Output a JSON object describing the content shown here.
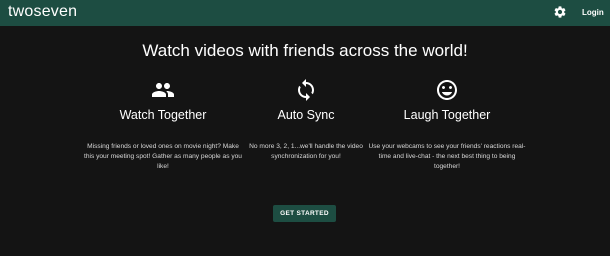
{
  "navbar": {
    "brand": "twoseven",
    "settings_icon": "gear-icon",
    "login_label": "Login"
  },
  "hero": {
    "title": "Watch videos with friends across the world!"
  },
  "features": [
    {
      "icon": "people-icon",
      "title": "Watch Together",
      "description": "Missing friends or loved ones on movie night? Make this your meeting spot! Gather as many people as you like!"
    },
    {
      "icon": "sync-icon",
      "title": "Auto Sync",
      "description": "No more 3, 2, 1...we'll handle the video synchronization for you!"
    },
    {
      "icon": "smiley-icon",
      "title": "Laugh Together",
      "description": "Use your webcams to see your friends' reactions real-time and live-chat - the next best thing to being together!"
    }
  ],
  "cta": {
    "label": "GET STARTED"
  },
  "colors": {
    "background": "#141414",
    "accent": "#1d4d42",
    "text": "#ffffff"
  }
}
